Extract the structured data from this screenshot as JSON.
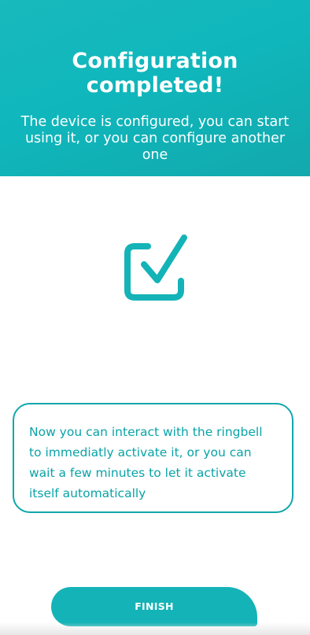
{
  "header": {
    "title": "Configuration completed!",
    "subtitle": "The device is configured, you can start using it, or you can configure another one"
  },
  "status_icon": "checkbox-checked-icon",
  "info": {
    "text": "Now you can interact with the ringbell to immediatly activate it, or you can wait a few minutes to let it activate itself automatically"
  },
  "actions": {
    "finish_label": "FINISH"
  },
  "colors": {
    "accent": "#12B3B7",
    "text_on_accent": "#FFFFFF",
    "info_text": "#0AA3A7"
  }
}
